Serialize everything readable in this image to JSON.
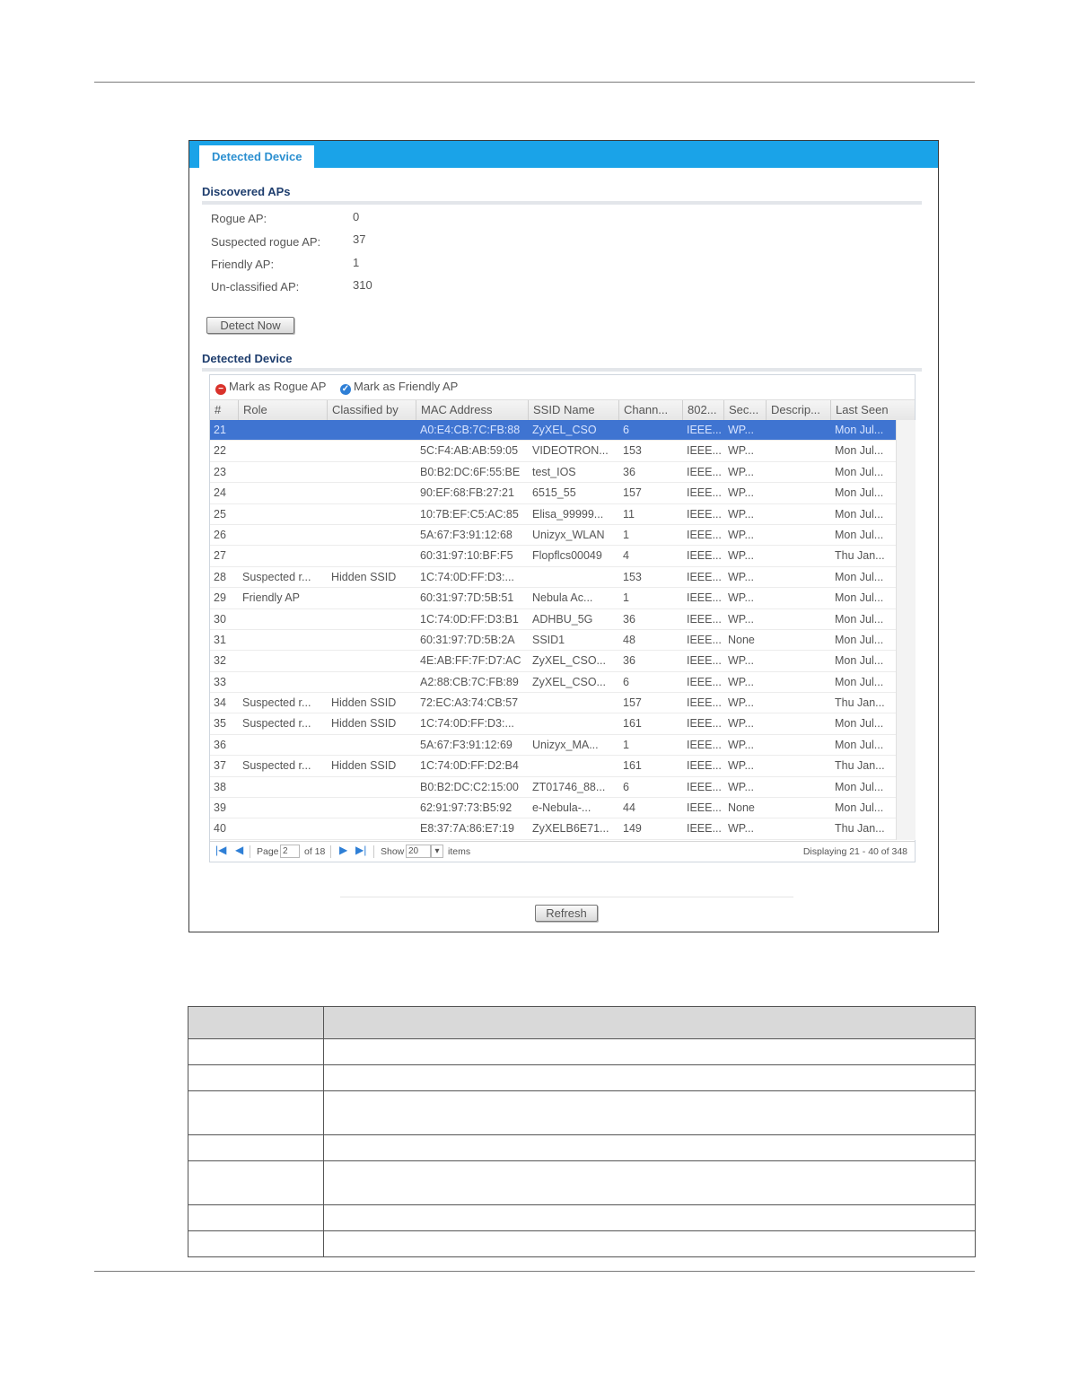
{
  "tab": {
    "label": "Detected Device"
  },
  "discovered": {
    "title": "Discovered APs",
    "stats": [
      {
        "label": "Rogue AP:",
        "value": "0"
      },
      {
        "label": "Suspected rogue AP:",
        "value": "37"
      },
      {
        "label": "Friendly AP:",
        "value": "1"
      },
      {
        "label": "Un-classified AP:",
        "value": "310"
      }
    ],
    "detect_button": "Detect Now"
  },
  "detected": {
    "title": "Detected Device",
    "mark_rogue": "Mark as Rogue AP",
    "mark_friendly": "Mark as Friendly AP"
  },
  "table": {
    "columns": [
      "#",
      "Role",
      "Classified by",
      "MAC Address",
      "SSID Name",
      "Chann...",
      "802...",
      "Sec...",
      "Descrip...",
      "Last Seen"
    ],
    "rows": [
      [
        "21",
        "",
        "",
        "A0:E4:CB:7C:FB:88",
        "ZyXEL_CSO",
        "6",
        "IEEE...",
        "WP...",
        "",
        "Mon Jul..."
      ],
      [
        "22",
        "",
        "",
        "5C:F4:AB:AB:59:05",
        "VIDEOTRON...",
        "153",
        "IEEE...",
        "WP...",
        "",
        "Mon Jul..."
      ],
      [
        "23",
        "",
        "",
        "B0:B2:DC:6F:55:BE",
        "test_IOS",
        "36",
        "IEEE...",
        "WP...",
        "",
        "Mon Jul..."
      ],
      [
        "24",
        "",
        "",
        "90:EF:68:FB:27:21",
        "6515_55",
        "157",
        "IEEE...",
        "WP...",
        "",
        "Mon Jul..."
      ],
      [
        "25",
        "",
        "",
        "10:7B:EF:C5:AC:85",
        "Elisa_99999...",
        "11",
        "IEEE...",
        "WP...",
        "",
        "Mon Jul..."
      ],
      [
        "26",
        "",
        "",
        "5A:67:F3:91:12:68",
        "Unizyx_WLAN",
        "1",
        "IEEE...",
        "WP...",
        "",
        "Mon Jul..."
      ],
      [
        "27",
        "",
        "",
        "60:31:97:10:BF:F5",
        "Flopflcs00049",
        "4",
        "IEEE...",
        "WP...",
        "",
        "Thu Jan..."
      ],
      [
        "28",
        "Suspected r...",
        "Hidden SSID",
        "1C:74:0D:FF:D3:...",
        "",
        "153",
        "IEEE...",
        "WP...",
        "",
        "Mon Jul..."
      ],
      [
        "29",
        "Friendly AP",
        "",
        "60:31:97:7D:5B:51",
        "Nebula Ac...",
        "1",
        "IEEE...",
        "WP...",
        "",
        "Mon Jul..."
      ],
      [
        "30",
        "",
        "",
        "1C:74:0D:FF:D3:B1",
        "ADHBU_5G",
        "36",
        "IEEE...",
        "WP...",
        "",
        "Mon Jul..."
      ],
      [
        "31",
        "",
        "",
        "60:31:97:7D:5B:2A",
        "SSID1",
        "48",
        "IEEE...",
        "None",
        "",
        "Mon Jul..."
      ],
      [
        "32",
        "",
        "",
        "4E:AB:FF:7F:D7:AC",
        "ZyXEL_CSO...",
        "36",
        "IEEE...",
        "WP...",
        "",
        "Mon Jul..."
      ],
      [
        "33",
        "",
        "",
        "A2:88:CB:7C:FB:89",
        "ZyXEL_CSO...",
        "6",
        "IEEE...",
        "WP...",
        "",
        "Mon Jul..."
      ],
      [
        "34",
        "Suspected r...",
        "Hidden SSID",
        "72:EC:A3:74:CB:57",
        "",
        "157",
        "IEEE...",
        "WP...",
        "",
        "Thu Jan..."
      ],
      [
        "35",
        "Suspected r...",
        "Hidden SSID",
        "1C:74:0D:FF:D3:...",
        "",
        "161",
        "IEEE...",
        "WP...",
        "",
        "Mon Jul..."
      ],
      [
        "36",
        "",
        "",
        "5A:67:F3:91:12:69",
        "Unizyx_MA...",
        "1",
        "IEEE...",
        "WP...",
        "",
        "Mon Jul..."
      ],
      [
        "37",
        "Suspected r...",
        "Hidden SSID",
        "1C:74:0D:FF:D2:B4",
        "",
        "161",
        "IEEE...",
        "WP...",
        "",
        "Thu Jan..."
      ],
      [
        "38",
        "",
        "",
        "B0:B2:DC:C2:15:00",
        "ZT01746_88...",
        "6",
        "IEEE...",
        "WP...",
        "",
        "Mon Jul..."
      ],
      [
        "39",
        "",
        "",
        "62:91:97:73:B5:92",
        "e-Nebula-...",
        "44",
        "IEEE...",
        "None",
        "",
        "Mon Jul..."
      ],
      [
        "40",
        "",
        "",
        "E8:37:7A:86:E7:19",
        "ZyXELB6E71...",
        "149",
        "IEEE...",
        "WP...",
        "",
        "Thu Jan..."
      ]
    ]
  },
  "pager": {
    "page_label": "Page",
    "page_value": "2",
    "of_label": "of 18",
    "show_label": "Show",
    "show_value": "20",
    "items_label": "items",
    "summary": "Displaying 21 - 40 of 348"
  },
  "refresh_button": "Refresh",
  "colors": {
    "tab_bar": "#1aa3e8",
    "selected_row": "#3f74d1",
    "rogue_icon": "#d9322b",
    "friendly_icon": "#2e7fd6"
  }
}
